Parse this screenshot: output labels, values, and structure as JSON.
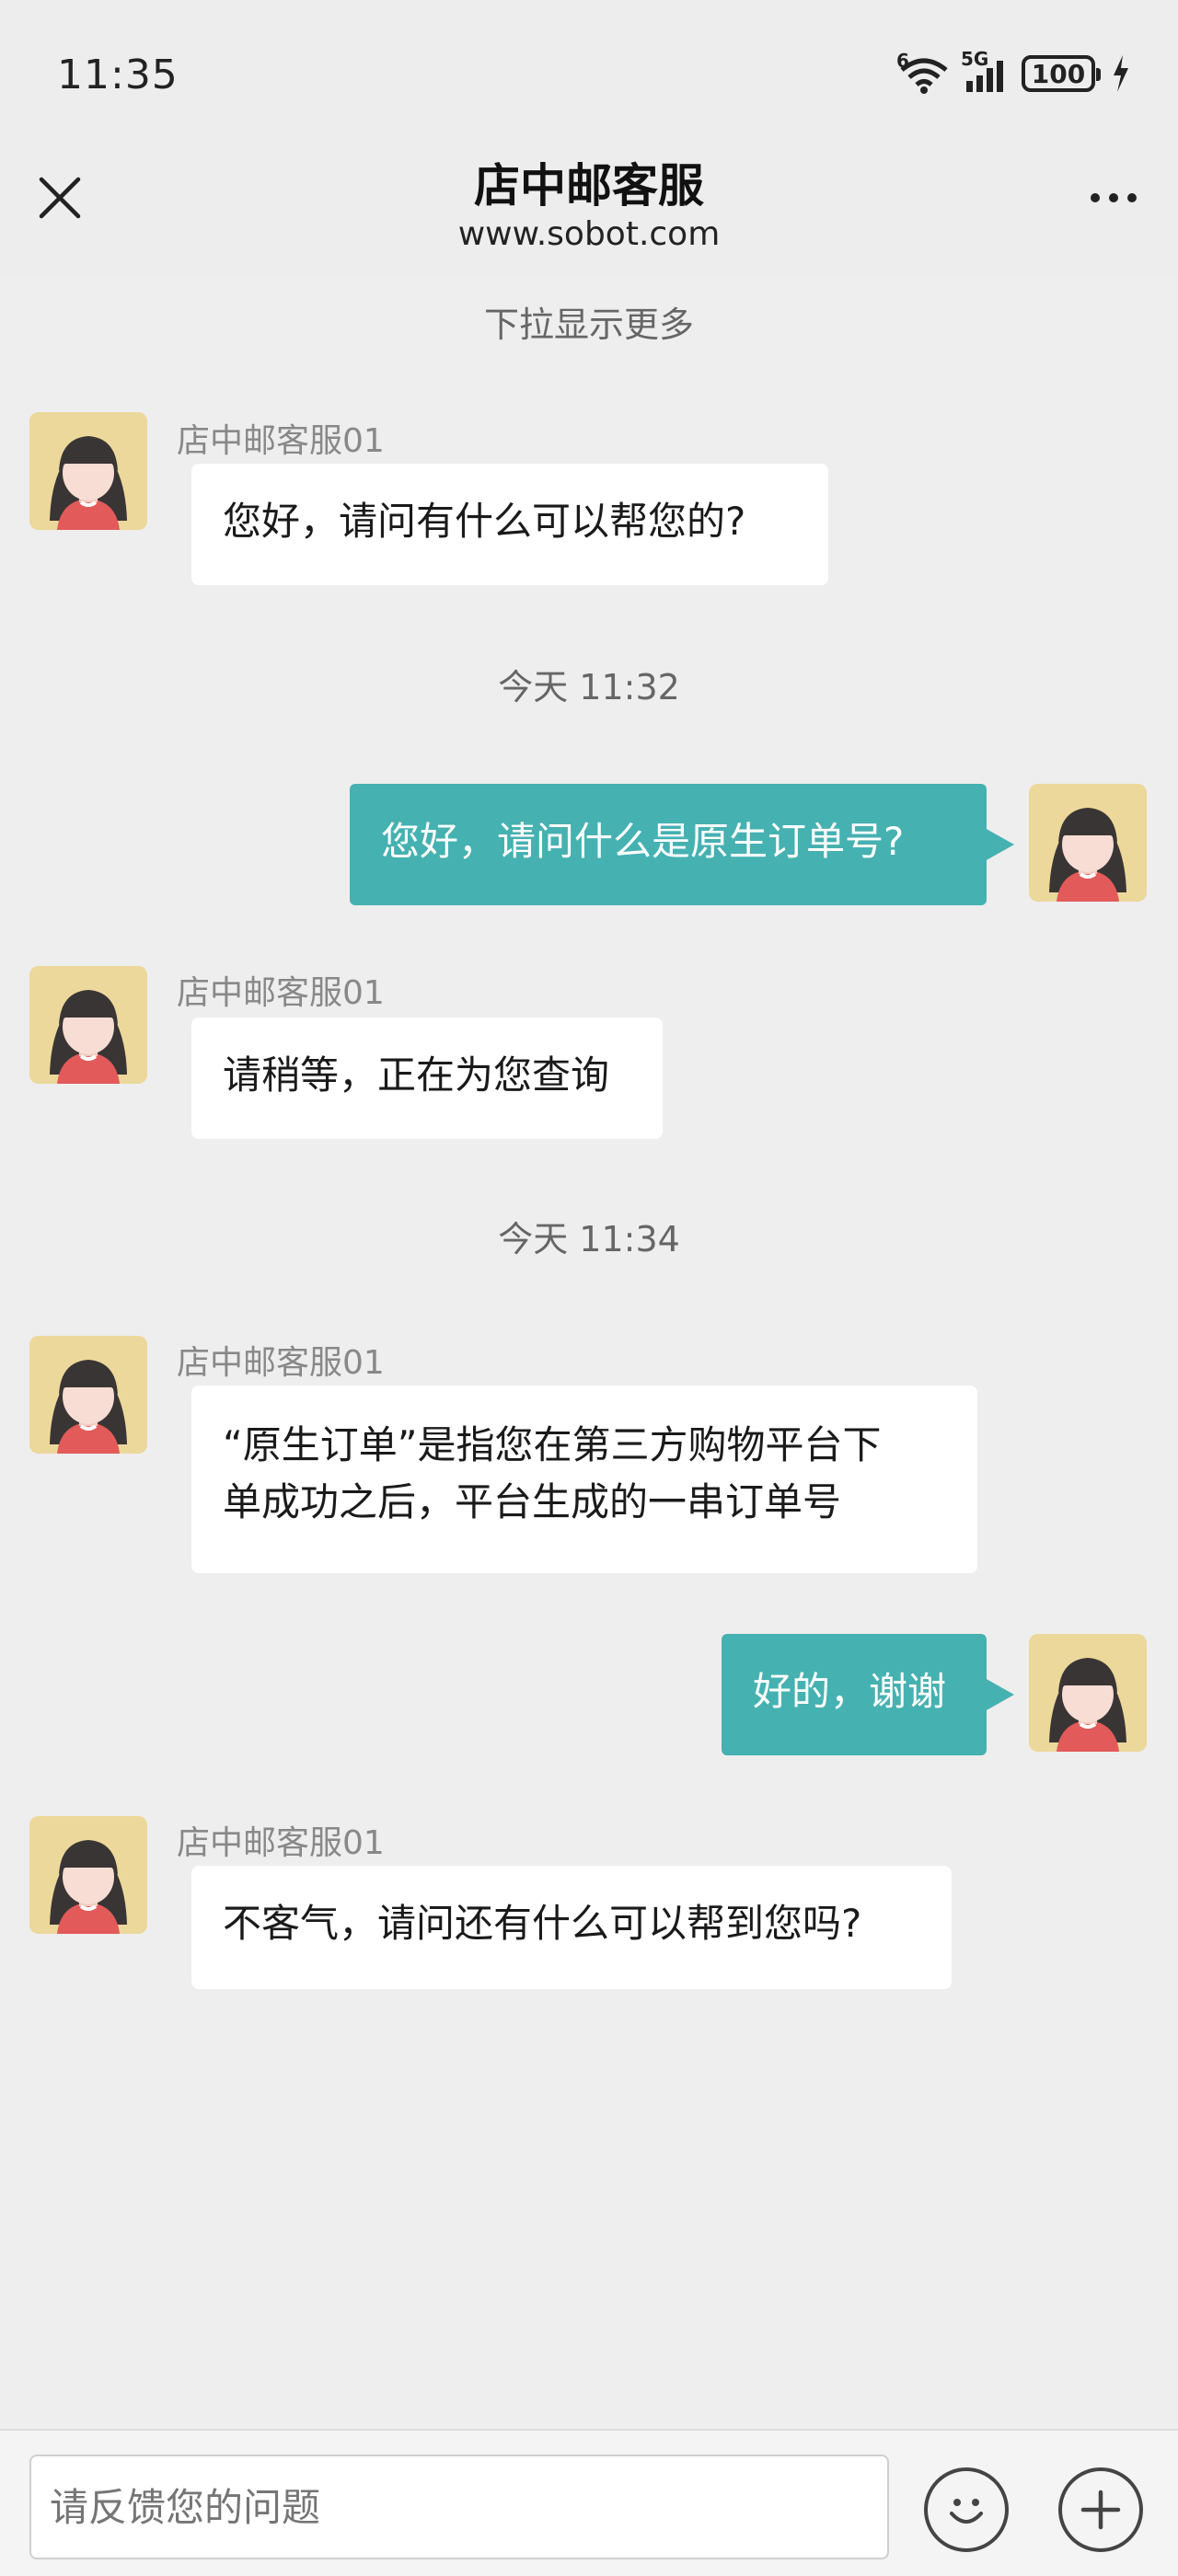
{
  "status_bar": {
    "time": "11:35",
    "wifi_label": "6",
    "network_label": "5G",
    "battery": "100"
  },
  "header": {
    "title": "店中邮客服",
    "subtitle": "www.sobot.com"
  },
  "chat": {
    "load_more": "下拉显示更多",
    "time_dividers": [
      "今天 11:32",
      "今天 11:34"
    ],
    "messages": [
      {
        "sender": "店中邮客服01",
        "text": "您好，请问有什么可以帮您的?"
      },
      {
        "sender": "",
        "text": "您好，请问什么是原生订单号?"
      },
      {
        "sender": "店中邮客服01",
        "text": "请稍等，正在为您查询"
      },
      {
        "sender": "店中邮客服01",
        "line1": "“原生订单”是指您在第三方购物平台下",
        "line2": "单成功之后，平台生成的一串订单号"
      },
      {
        "sender": "",
        "text": "好的，谢谢"
      },
      {
        "sender": "店中邮客服01",
        "text": "不客气，请问还有什么可以帮到您吗?"
      }
    ]
  },
  "input": {
    "placeholder": "请反馈您的问题"
  },
  "colors": {
    "user_bubble": "#46b1b1",
    "agent_bubble": "#ffffff",
    "background": "#eeeeee",
    "avatar_bg": "#ecd89b"
  }
}
